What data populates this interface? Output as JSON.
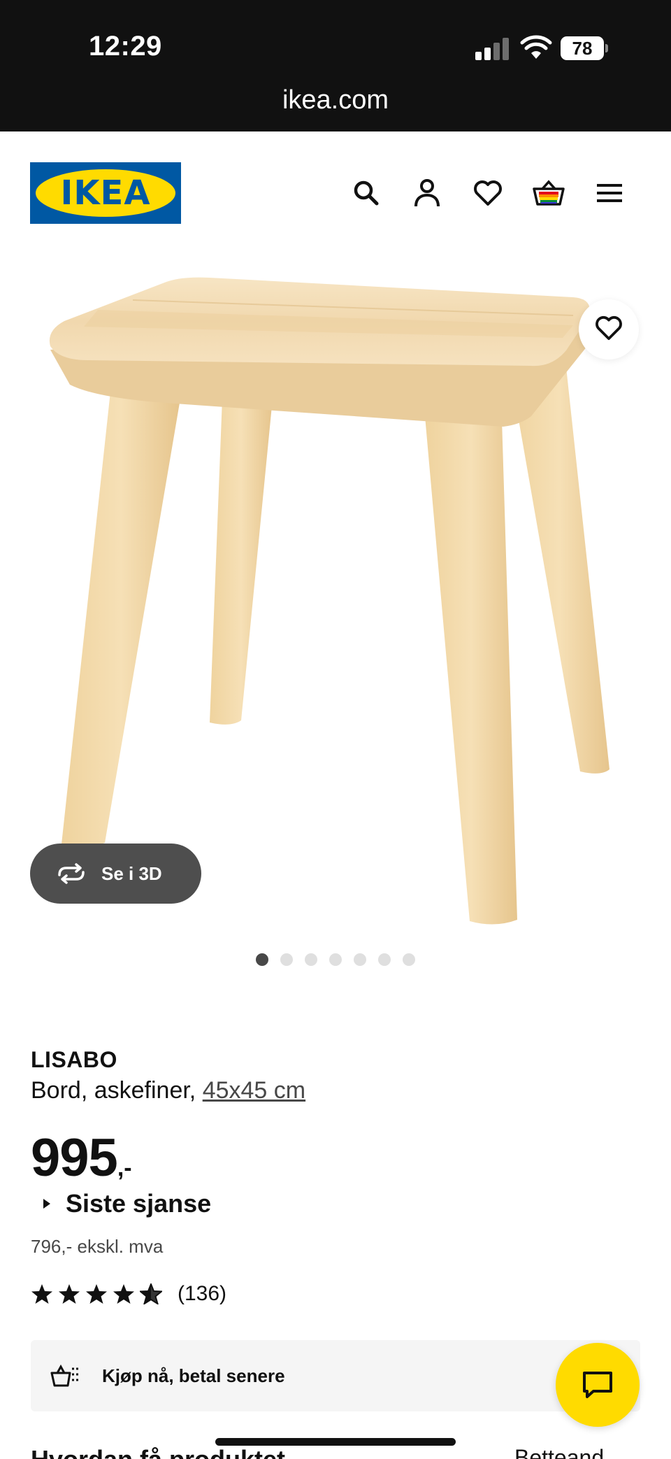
{
  "status_bar": {
    "time": "12:29",
    "battery": "78",
    "url": "ikea.com"
  },
  "header": {
    "logo_text": "IKEA",
    "icons": [
      "search-icon",
      "account-icon",
      "heart-icon",
      "basket-icon",
      "menu-icon"
    ],
    "colors": {
      "logo_blue": "#0058a3",
      "logo_yellow": "#ffdb00"
    }
  },
  "gallery": {
    "see_3d_label": "Se i 3D",
    "slide_count": 7,
    "active_slide": 1
  },
  "product": {
    "name": "LISABO",
    "description": "Bord, askefiner,",
    "size_link": "45x45 cm",
    "price": "995",
    "price_suffix": ",-",
    "last_chance": "Siste sjanse",
    "ex_vat": "796,- ekskl. mva",
    "rating": 4.5,
    "review_count": "(136)"
  },
  "bnpl": {
    "label": "Kjøp nå, betal senere"
  },
  "bottom": {
    "left_cut_text": "Hvordan få produktet",
    "right_cut_text": "Betteand"
  },
  "colors": {
    "chat_button": "#ffdb00",
    "see3d_bg": "#4e4e4e"
  }
}
